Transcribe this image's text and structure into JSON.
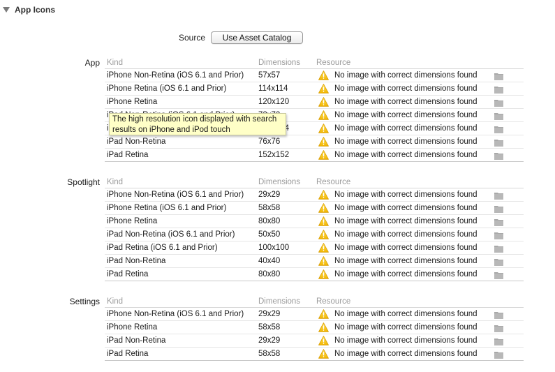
{
  "header": {
    "title": "App Icons",
    "disclosure_icon": "disclosure-triangle-down-icon"
  },
  "source": {
    "label": "Source",
    "button_label": "Use Asset Catalog"
  },
  "columns": {
    "kind": "Kind",
    "dimensions": "Dimensions",
    "resource": "Resource"
  },
  "colors": {
    "warning": "#f5c400",
    "folder": "#a9a9a9",
    "tooltip_bg": "#ffffc7"
  },
  "sections": [
    {
      "label": "App",
      "rows": [
        {
          "kind": "iPhone Non-Retina (iOS 6.1 and Prior)",
          "dimensions": "57x57",
          "resource": "No image with correct dimensions found"
        },
        {
          "kind": "iPhone Retina (iOS 6.1 and Prior)",
          "dimensions": "114x114",
          "resource": "No image with correct dimensions found"
        },
        {
          "kind": "iPhone Retina",
          "dimensions": "120x120",
          "resource": "No image with correct dimensions found"
        },
        {
          "kind": "iPad Non-Retina (iOS 6.1 and Prior)",
          "dimensions": "72x72",
          "resource": "No image with correct dimensions found"
        },
        {
          "kind": "iPad Retina (iOS 6.1 and Prior)",
          "dimensions": "144x144",
          "resource": "No image with correct dimensions found"
        },
        {
          "kind": "iPad Non-Retina",
          "dimensions": "76x76",
          "resource": "No image with correct dimensions found"
        },
        {
          "kind": "iPad Retina",
          "dimensions": "152x152",
          "resource": "No image with correct dimensions found"
        }
      ]
    },
    {
      "label": "Spotlight",
      "rows": [
        {
          "kind": "iPhone Non-Retina (iOS 6.1 and Prior)",
          "dimensions": "29x29",
          "resource": "No image with correct dimensions found"
        },
        {
          "kind": "iPhone Retina (iOS 6.1 and Prior)",
          "dimensions": "58x58",
          "resource": "No image with correct dimensions found"
        },
        {
          "kind": "iPhone Retina",
          "dimensions": "80x80",
          "resource": "No image with correct dimensions found"
        },
        {
          "kind": "iPad Non-Retina (iOS 6.1 and Prior)",
          "dimensions": "50x50",
          "resource": "No image with correct dimensions found"
        },
        {
          "kind": "iPad Retina (iOS 6.1 and Prior)",
          "dimensions": "100x100",
          "resource": "No image with correct dimensions found"
        },
        {
          "kind": "iPad Non-Retina",
          "dimensions": "40x40",
          "resource": "No image with correct dimensions found"
        },
        {
          "kind": "iPad Retina",
          "dimensions": "80x80",
          "resource": "No image with correct dimensions found"
        }
      ]
    },
    {
      "label": "Settings",
      "rows": [
        {
          "kind": "iPhone Non-Retina (iOS 6.1 and Prior)",
          "dimensions": "29x29",
          "resource": "No image with correct dimensions found"
        },
        {
          "kind": "iPhone Retina",
          "dimensions": "58x58",
          "resource": "No image with correct dimensions found"
        },
        {
          "kind": "iPad Non-Retina",
          "dimensions": "29x29",
          "resource": "No image with correct dimensions found"
        },
        {
          "kind": "iPad Retina",
          "dimensions": "58x58",
          "resource": "No image with correct dimensions found"
        }
      ]
    }
  ],
  "tooltip": {
    "text": "The high resolution icon displayed with search results on iPhone and iPod touch"
  }
}
